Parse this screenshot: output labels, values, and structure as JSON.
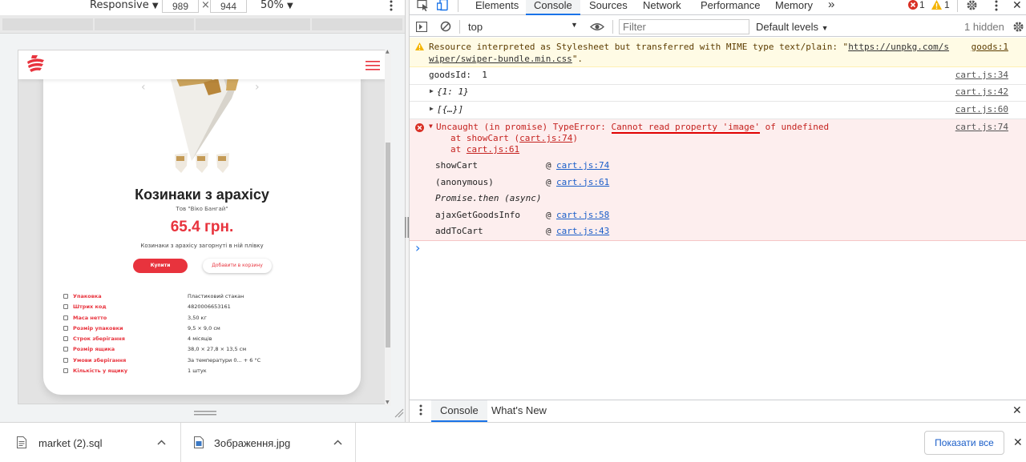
{
  "device_toolbar": {
    "mode": "Responsive",
    "mode_arrow": "▼",
    "width": "989",
    "times": "×",
    "height": "944",
    "zoom": "50%",
    "zoom_arrow": "▼",
    "more_icon": "vertical-dots-icon"
  },
  "site": {
    "product": {
      "title": "Козинаки з арахісу",
      "seller": "Тов \"Віко Бангай\"",
      "price": "65.4 грн.",
      "description": "Козинаки з арахісу загорнуті в ній плівку",
      "buy_label": "Купити",
      "add_to_cart_label": "Добавити в корзину"
    },
    "specs": [
      {
        "label": "Упаковка",
        "value": "Пластиковий стакан"
      },
      {
        "label": "Штрих код",
        "value": "4820006653161"
      },
      {
        "label": "Маса нетто",
        "value": "3,50 кг"
      },
      {
        "label": "Розмір упаковки",
        "value": "9,5 × 9,0 см"
      },
      {
        "label": "Строк зберігання",
        "value": "4 місяців"
      },
      {
        "label": "Розмір ящика",
        "value": "38,0 × 27,8 × 13,5 см"
      },
      {
        "label": "Умови зберігання",
        "value": "За температури 0... + 6 °С"
      },
      {
        "label": "Кількість у ящику",
        "value": "1 штук"
      }
    ]
  },
  "devtools": {
    "tabs": [
      "Elements",
      "Console",
      "Sources",
      "Network",
      "Performance",
      "Memory"
    ],
    "active_tab": "Console",
    "more_tabs": "»",
    "error_count": "1",
    "warning_count": "1",
    "context": "top",
    "filter_placeholder": "Filter",
    "levels": "Default levels",
    "hidden": "1 hidden",
    "warning_message": {
      "line1_text": "Resource interpreted as Stylesheet but transferred with MIME type text/plain: \"",
      "line1_link": "https://unpkg.com/s",
      "line1_src": "goods:1",
      "line2_link": "wiper/swiper-bundle.min.css",
      "line2_tail": "\"."
    },
    "logs": [
      {
        "text": "goodsId:  1",
        "src": "cart.js:34"
      },
      {
        "text": "{1: 1}",
        "src": "cart.js:42"
      },
      {
        "text": "[{…}]",
        "src": "cart.js:60"
      }
    ],
    "error_message": {
      "prefix": "Uncaught (in promise) TypeError: ",
      "highlight": "Cannot read property 'image'",
      "suffix": " of undefined",
      "src": "cart.js:74",
      "stack1_pre": "at showCart (",
      "stack1_link": "cart.js:74",
      "stack1_post": ")",
      "stack2_pre": "at ",
      "stack2_link": "cart.js:61"
    },
    "call_stack": [
      {
        "fn": "showCart",
        "at": "@",
        "link": "cart.js:74",
        "italic": false
      },
      {
        "fn": "(anonymous)",
        "at": "@",
        "link": "cart.js:61",
        "italic": false
      },
      {
        "fn": "Promise.then (async)",
        "at": "",
        "link": "",
        "italic": true
      },
      {
        "fn": "ajaxGetGoodsInfo",
        "at": "@",
        "link": "cart.js:58",
        "italic": false
      },
      {
        "fn": "addToCart",
        "at": "@",
        "link": "cart.js:43",
        "italic": false
      }
    ],
    "prompt": "›",
    "drawer_tabs": [
      "Console",
      "What's New"
    ],
    "drawer_close": "✕"
  },
  "downloads": {
    "items": [
      {
        "name": "market (2).sql"
      },
      {
        "name": "Зображення.jpg"
      }
    ],
    "show_all": "Показати все",
    "close": "✕"
  },
  "colors": {
    "accent_red": "#e8333d",
    "link_blue": "#1a5ec9",
    "devtools_active": "#1a73e8",
    "error_bg": "#fdeeee",
    "warning_bg": "#fffbe5"
  }
}
